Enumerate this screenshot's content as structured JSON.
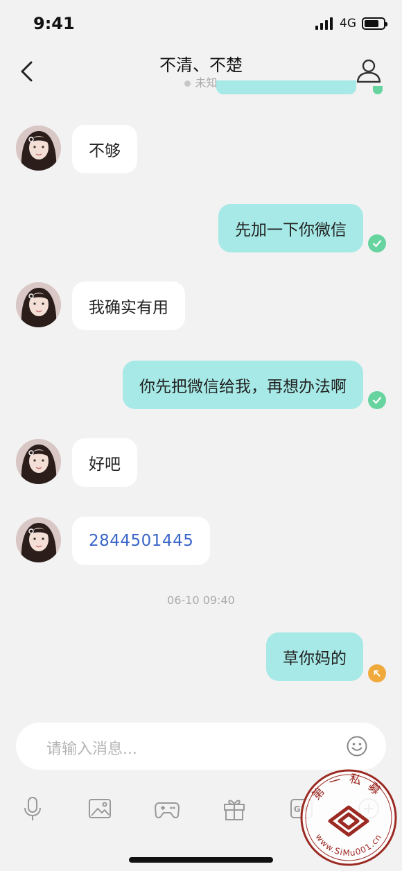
{
  "status_bar": {
    "time": "9:41",
    "network": "4G",
    "battery_level": 0.75
  },
  "header": {
    "title": "不清、不楚",
    "subtitle": "未知"
  },
  "messages": [
    {
      "direction": "in",
      "text": "不够"
    },
    {
      "direction": "out",
      "text": "先加一下你微信",
      "status": "read"
    },
    {
      "direction": "in",
      "text": "我确实有用"
    },
    {
      "direction": "out",
      "text": "你先把微信给我，再想办法啊",
      "status": "read"
    },
    {
      "direction": "in",
      "text": "好吧"
    },
    {
      "direction": "in",
      "text": "2844501445",
      "is_link": true
    },
    {
      "timestamp": "06-10 09:40"
    },
    {
      "direction": "out",
      "text": "草你妈的",
      "status": "failed"
    }
  ],
  "input": {
    "placeholder": "请输入消息..."
  },
  "toolbar": {
    "items": [
      "microphone-icon",
      "image-icon",
      "gamepad-icon",
      "gift-icon",
      "gif-icon",
      "plus-icon"
    ],
    "gif_label": "GIF"
  },
  "watermark": {
    "text_top": "第一私募",
    "text_bottom": "www.SiMu001.cn"
  },
  "colors": {
    "background": "#f2f2f2",
    "outgoing_bubble": "#a6e9e6",
    "incoming_bubble": "#ffffff",
    "read_check": "#67d4a0",
    "failed_status": "#f0a93b",
    "link": "#3a66c9",
    "watermark": "#9b2a23"
  }
}
